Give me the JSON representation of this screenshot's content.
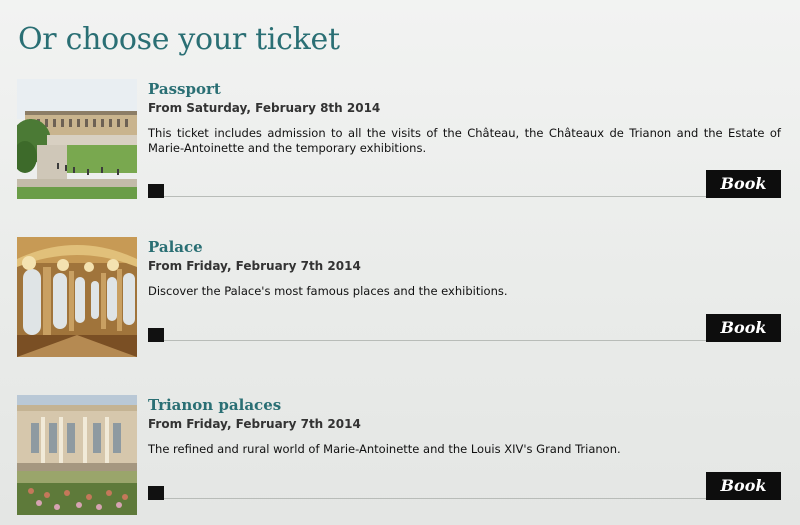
{
  "page": {
    "heading": "Or choose your ticket"
  },
  "tickets": [
    {
      "title": "Passport",
      "date": "From Saturday, February 8th 2014",
      "description": "This ticket includes admission to all the visits of the Château, the Châteaux de Trianon and the Estate of Marie-Antoinette and the temporary exhibitions.",
      "book_label": "Book",
      "image": "palace-gardens-photo"
    },
    {
      "title": "Palace",
      "date": "From Friday, February 7th 2014",
      "description": "Discover the Palace's most famous places and the exhibitions.",
      "book_label": "Book",
      "image": "hall-of-mirrors-photo"
    },
    {
      "title": "Trianon palaces",
      "date": "From Friday, February 7th 2014",
      "description": "The refined and rural world of Marie-Antoinette and the Louis XIV's Grand Trianon.",
      "book_label": "Book",
      "image": "grand-trianon-photo"
    }
  ],
  "colors": {
    "accent": "#2a6f74",
    "button": "#0d0d0d",
    "rule": "#b8bcb8"
  }
}
